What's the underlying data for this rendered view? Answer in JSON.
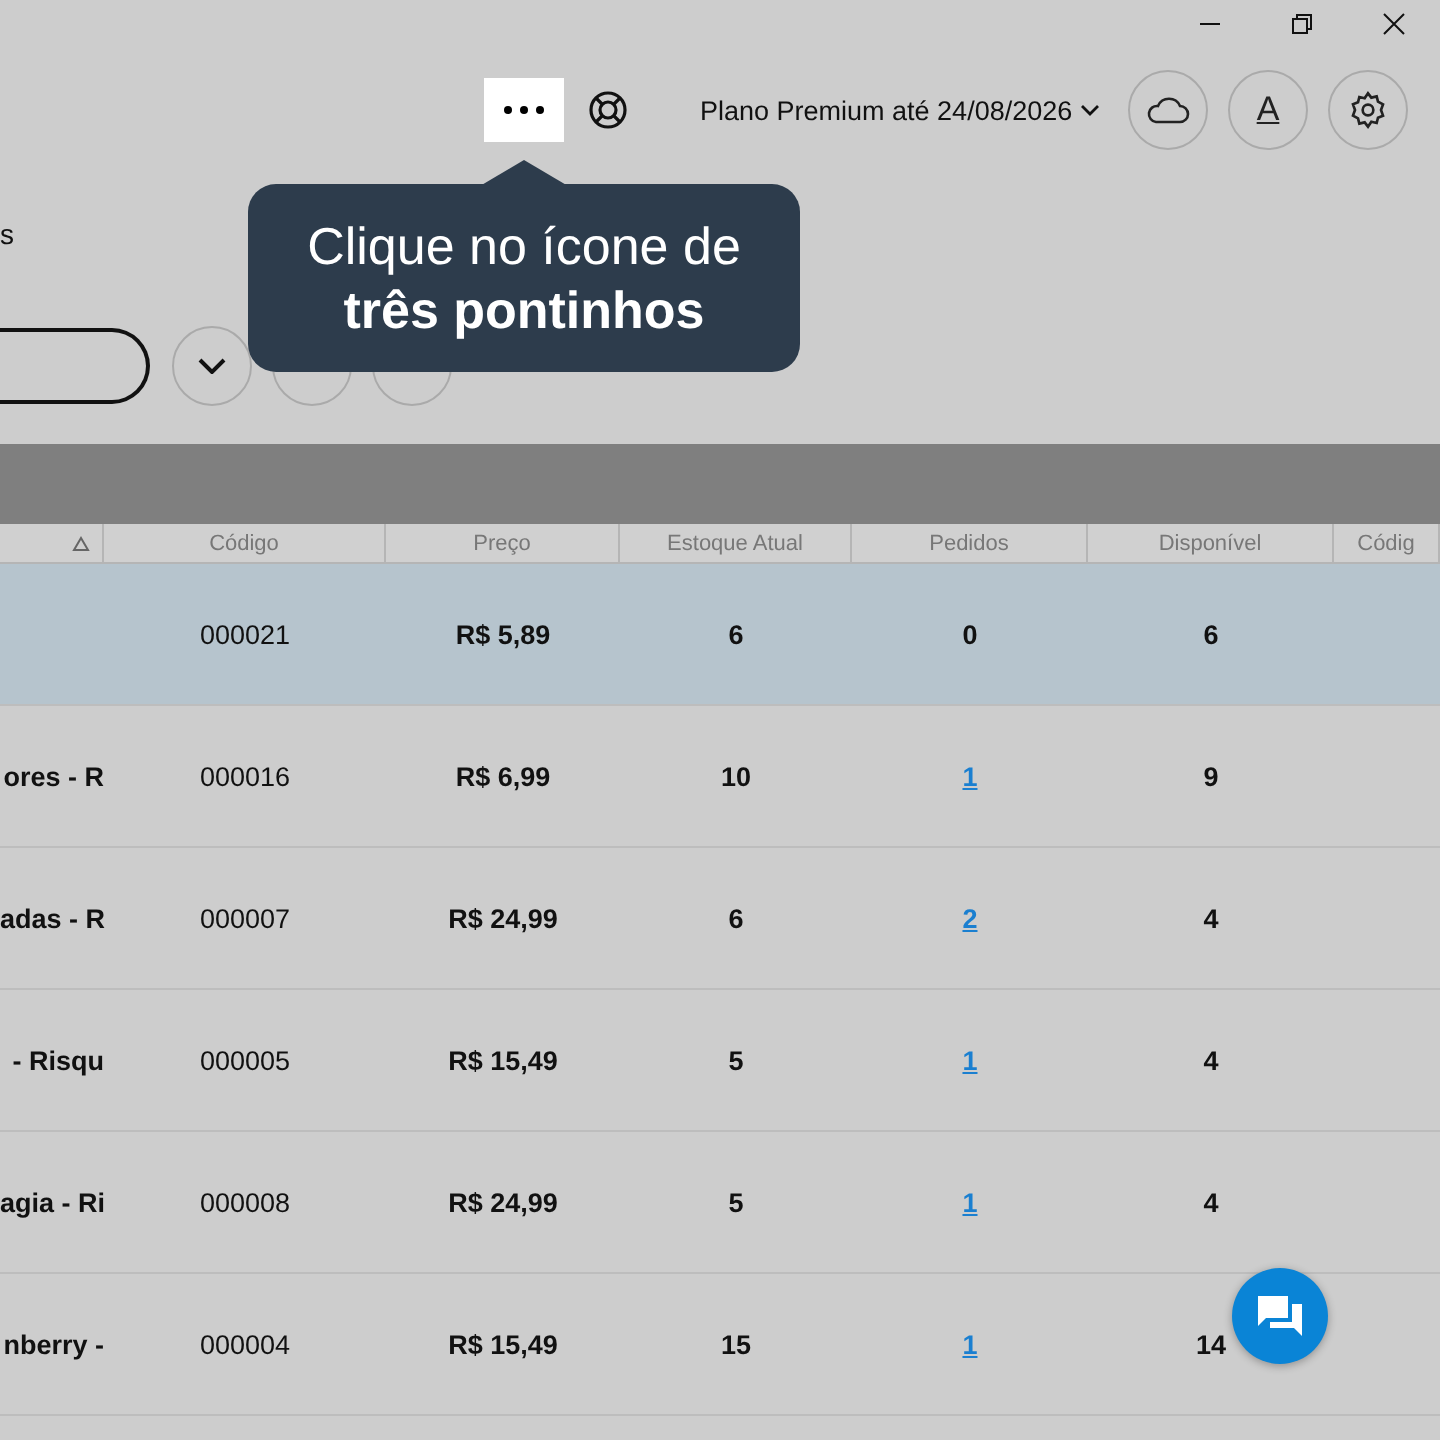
{
  "header": {
    "plan": "Plano Premium até 24/08/2026",
    "font_button": "A"
  },
  "sidebar_fragment": "s",
  "tooltip": {
    "text": "Clique no ícone de\n**três pontinhos**"
  },
  "table": {
    "columns": [
      {
        "sorted": true
      },
      {
        "label": "Código",
        "sorted": false
      },
      {
        "label": "Preço",
        "sorted": false
      },
      {
        "label": "Estoque Atual",
        "sorted": false
      },
      {
        "label": "Pedidos",
        "sorted": false
      },
      {
        "label": "Disponível",
        "sorted": false
      },
      {
        "label": "Códig",
        "sorted": false
      }
    ],
    "rows": [
      {
        "selected": true,
        "code": "000021",
        "price": "R$ 5,89",
        "stock": "6",
        "orders": {
          "text": "0",
          "link": false
        },
        "available": "6"
      },
      {
        "selected": false,
        "name": "ores - R",
        "code": "000016",
        "price": "R$ 6,99",
        "stock": "10",
        "orders": {
          "text": "1",
          "link": true
        },
        "available": "9"
      },
      {
        "selected": false,
        "name": "adas - R",
        "code": "000007",
        "price": "R$ 24,99",
        "stock": "6",
        "orders": {
          "text": "2",
          "link": true
        },
        "available": "4"
      },
      {
        "selected": false,
        "name": "- Risqu",
        "code": "000005",
        "price": "R$ 15,49",
        "stock": "5",
        "orders": {
          "text": "1",
          "link": true
        },
        "available": "4"
      },
      {
        "selected": false,
        "name": "agia - Ri",
        "code": "000008",
        "price": "R$ 24,99",
        "stock": "5",
        "orders": {
          "text": "1",
          "link": true
        },
        "available": "4"
      },
      {
        "selected": false,
        "name": "nberry -",
        "code": "000004",
        "price": "R$ 15,49",
        "stock": "15",
        "orders": {
          "text": "1",
          "link": true
        },
        "available": "14"
      }
    ]
  }
}
